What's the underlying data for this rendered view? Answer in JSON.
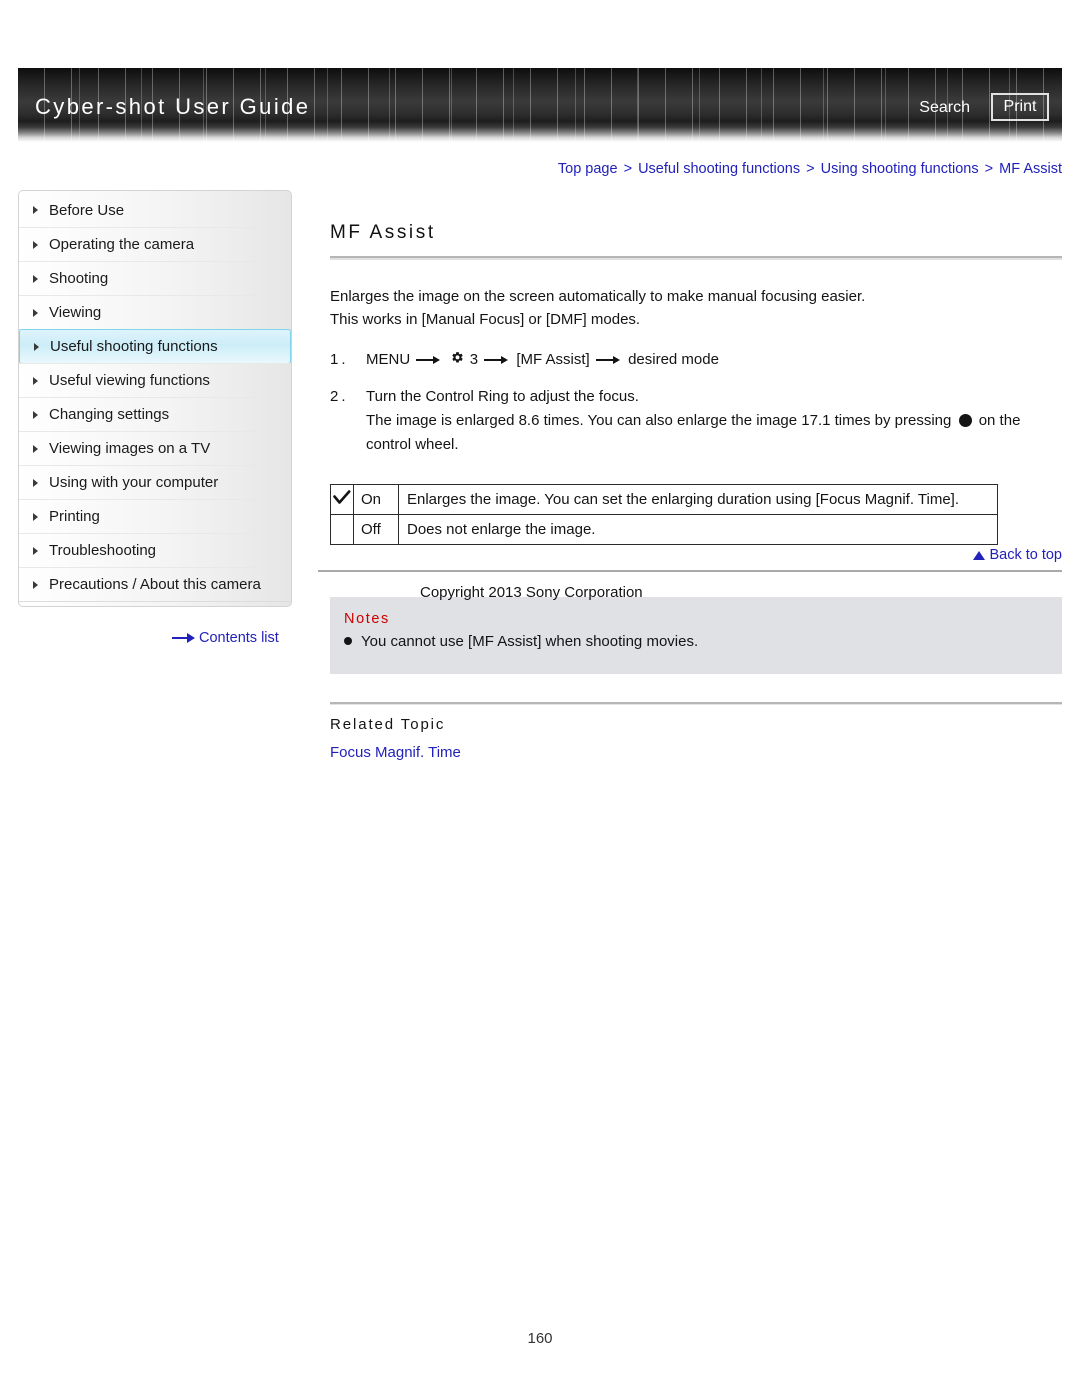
{
  "header": {
    "title": "Cyber-shot User Guide",
    "search_label": "Search",
    "print_label": "Print"
  },
  "breadcrumb": {
    "items": [
      {
        "label": "Top page",
        "current": false
      },
      {
        "label": "Useful shooting functions",
        "current": false
      },
      {
        "label": "Using shooting functions",
        "current": false
      },
      {
        "label": "MF Assist",
        "current": true
      }
    ],
    "separator": ">"
  },
  "sidebar": {
    "items": [
      {
        "label": "Before Use",
        "active": false
      },
      {
        "label": "Operating the camera",
        "active": false
      },
      {
        "label": "Shooting",
        "active": false
      },
      {
        "label": "Viewing",
        "active": false
      },
      {
        "label": "Useful shooting functions",
        "active": true
      },
      {
        "label": "Useful viewing functions",
        "active": false
      },
      {
        "label": "Changing settings",
        "active": false
      },
      {
        "label": "Viewing images on a TV",
        "active": false
      },
      {
        "label": "Using with your computer",
        "active": false
      },
      {
        "label": "Printing",
        "active": false
      },
      {
        "label": "Troubleshooting",
        "active": false
      },
      {
        "label": "Precautions / About this camera",
        "active": false
      }
    ],
    "contents_list_label": "Contents list"
  },
  "main": {
    "title": "MF Assist",
    "intro_line1": "Enlarges the image on the screen automatically to make manual focusing easier.",
    "intro_line2": "This works in [Manual Focus] or [DMF] modes.",
    "steps": [
      {
        "num": "1.",
        "parts": {
          "menu": "MENU",
          "gear_number": "3",
          "setting": "[MF Assist]",
          "target": "desired mode"
        }
      },
      {
        "num": "2.",
        "line1": "Turn the Control Ring to adjust the focus.",
        "line2a": "The image is enlarged 8.6 times. You can also enlarge the image 17.1 times by pressing",
        "line2b": "on the",
        "line3": "control wheel."
      }
    ],
    "table": {
      "rows": [
        {
          "checked": true,
          "name": "On",
          "description": "Enlarges the image. You can set the enlarging duration using [Focus Magnif. Time]."
        },
        {
          "checked": false,
          "name": "Off",
          "description": "Does not enlarge the image."
        }
      ]
    },
    "notes": {
      "title": "Notes",
      "items": [
        "You cannot use [MF Assist] when shooting movies."
      ]
    },
    "related": {
      "title": "Related Topic",
      "links": [
        "Focus Magnif. Time"
      ]
    },
    "back_to_top_label": "Back to top",
    "copyright": "Copyright 2013 Sony Corporation"
  },
  "footer": {
    "page_number": "160"
  },
  "colors": {
    "link": "#2222bb",
    "notes_title": "#cc0000",
    "notes_bg": "#dfe1e4",
    "sidebar_active_border": "#7fd4ec"
  }
}
